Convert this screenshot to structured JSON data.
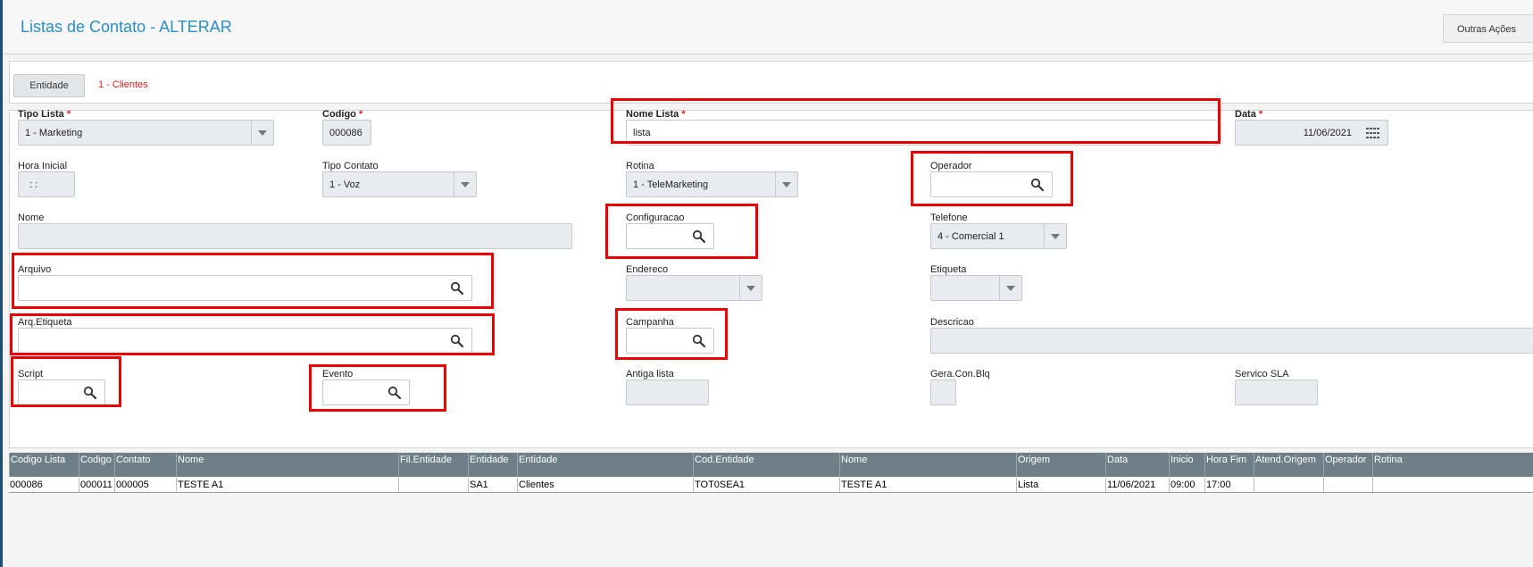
{
  "header": {
    "title": "Listas de Contato - ALTERAR",
    "outras_acoes": "Outras Ações"
  },
  "entidade": {
    "button_label": "Entidade",
    "value": "1 - Clientes"
  },
  "form": {
    "required_mark": "*",
    "tipo_lista": {
      "label": "Tipo Lista",
      "value": "1 - Marketing"
    },
    "codigo": {
      "label": "Codigo",
      "value": "000086"
    },
    "nome_lista": {
      "label": "Nome Lista",
      "value": "lista"
    },
    "data": {
      "label": "Data",
      "value": "11/06/2021"
    },
    "hora_inicial": {
      "label": "Hora Inicial",
      "value": ": :"
    },
    "tipo_contato": {
      "label": "Tipo Contato",
      "value": "1 - Voz"
    },
    "rotina": {
      "label": "Rotina",
      "value": "1 - TeleMarketing"
    },
    "operador": {
      "label": "Operador",
      "value": ""
    },
    "nome": {
      "label": "Nome",
      "value": ""
    },
    "configuracao": {
      "label": "Configuracao",
      "value": ""
    },
    "telefone": {
      "label": "Telefone",
      "value": "4 - Comercial 1"
    },
    "arquivo": {
      "label": "Arquivo",
      "value": ""
    },
    "endereco": {
      "label": "Endereco",
      "value": ""
    },
    "etiqueta": {
      "label": "Etiqueta",
      "value": ""
    },
    "arq_etiqueta": {
      "label": "Arq.Etiqueta",
      "value": ""
    },
    "campanha": {
      "label": "Campanha",
      "value": ""
    },
    "descricao": {
      "label": "Descricao",
      "value": ""
    },
    "script": {
      "label": "Script",
      "value": ""
    },
    "evento": {
      "label": "Evento",
      "value": ""
    },
    "antiga_lista": {
      "label": "Antiga lista",
      "value": ""
    },
    "gera_con_blq": {
      "label": "Gera.Con.Blq",
      "value": ""
    },
    "servico_sla": {
      "label": "Servico SLA",
      "value": ""
    }
  },
  "grid": {
    "columns": [
      "Codigo Lista",
      "Codigo",
      "Contato",
      "Nome",
      "Fil.Entidade",
      "Entidade",
      "Entidade",
      "Cod.Entidade",
      "Nome",
      "Origem",
      "Data",
      "Inicio",
      "Hora Fim",
      "Atend.Origem",
      "Operador",
      "Rotina"
    ],
    "rows": [
      [
        "000086",
        "000011",
        "000005",
        "TESTE A1",
        "",
        "SA1",
        "Clientes",
        "TOT0SEA1",
        "TESTE A1",
        "Lista",
        "11/06/2021",
        "09:00",
        "17:00",
        "",
        "",
        ""
      ]
    ]
  },
  "colors": {
    "accent": "#2a8fc7",
    "required": "#e0201a",
    "highlight": "#ee0000",
    "grid_header": "#6e7f87"
  },
  "icons": {
    "search": "search-icon",
    "dropdown": "chevron-down-icon",
    "calendar": "calendar-icon"
  }
}
